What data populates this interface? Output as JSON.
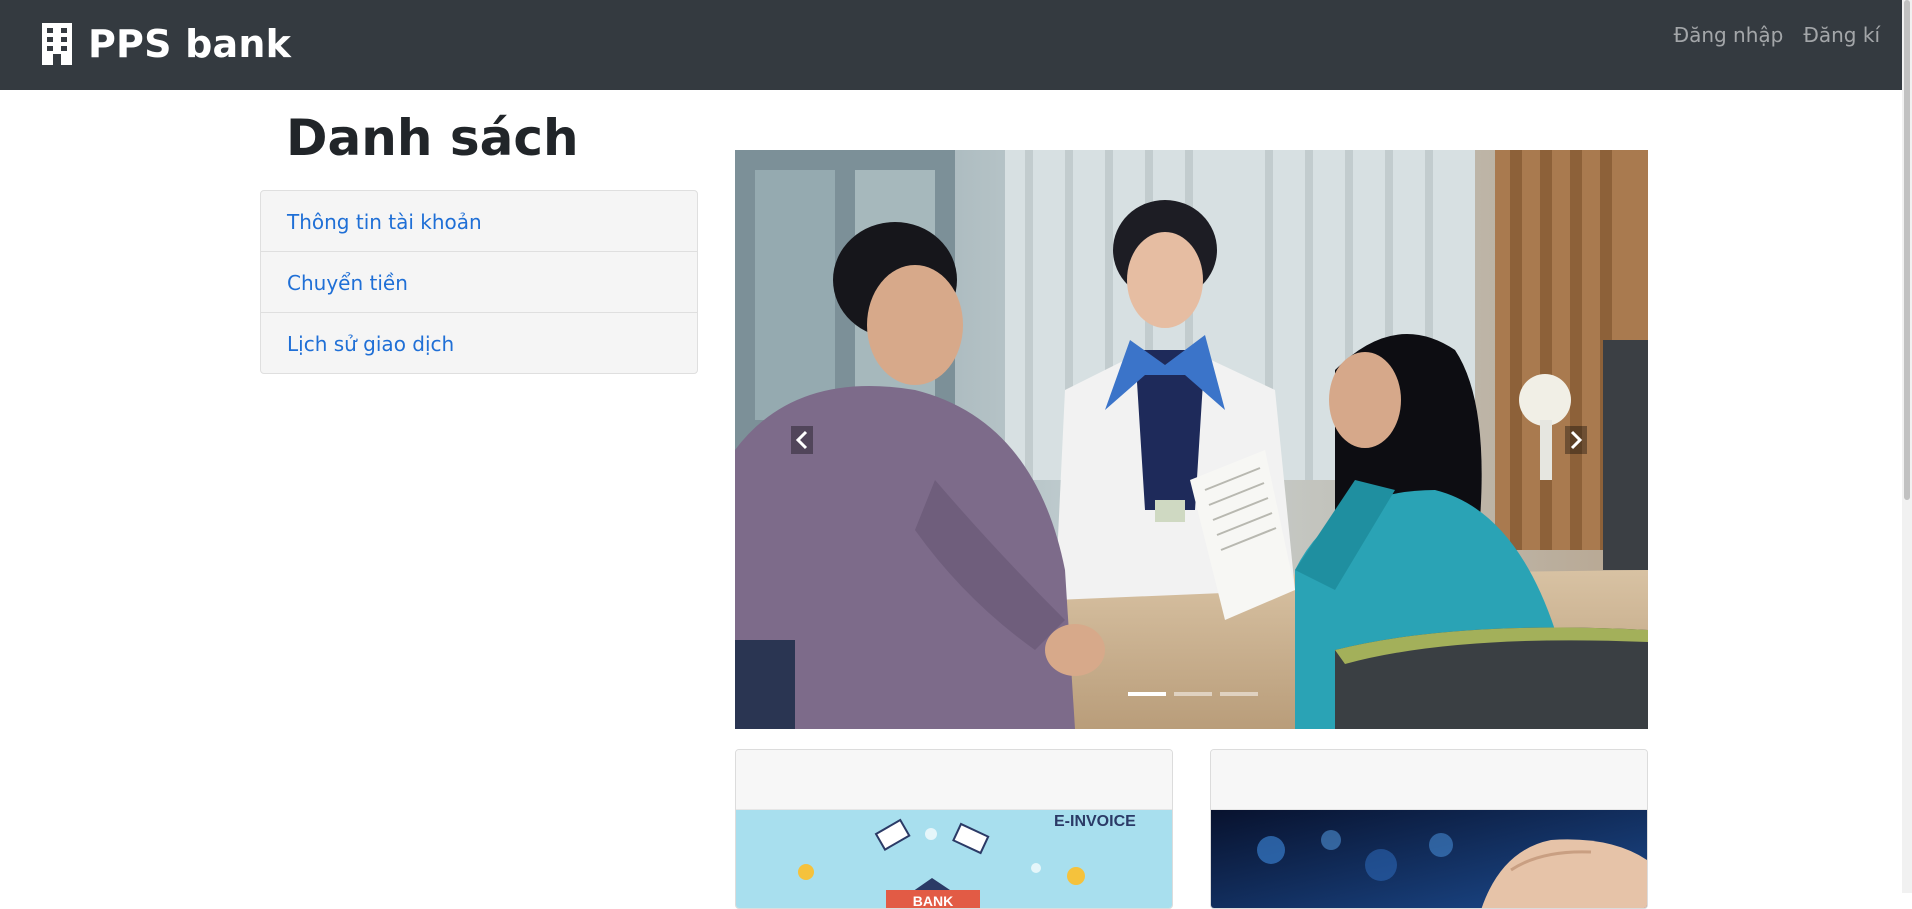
{
  "navbar": {
    "brand_icon": "building-icon",
    "brand": "PPS bank",
    "links": [
      {
        "label": "Đăng nhập"
      },
      {
        "label": "Đăng kí"
      }
    ]
  },
  "sidebar": {
    "title": "Danh sách",
    "items": [
      {
        "label": "Thông tin tài khoản"
      },
      {
        "label": "Chuyển tiền"
      },
      {
        "label": "Lịch sử giao dịch"
      }
    ]
  },
  "carousel": {
    "prev_icon": "chevron-left-icon",
    "next_icon": "chevron-right-icon",
    "slide_count": 3,
    "active_slide": 1
  },
  "cards": [
    {
      "image_text": "E-INVOICE",
      "badge": "BANK"
    },
    {
      "image_text": ""
    }
  ],
  "colors": {
    "navbar_bg": "#343a40",
    "link_blue": "#1f6fd6",
    "list_bg": "#f5f5f5"
  }
}
